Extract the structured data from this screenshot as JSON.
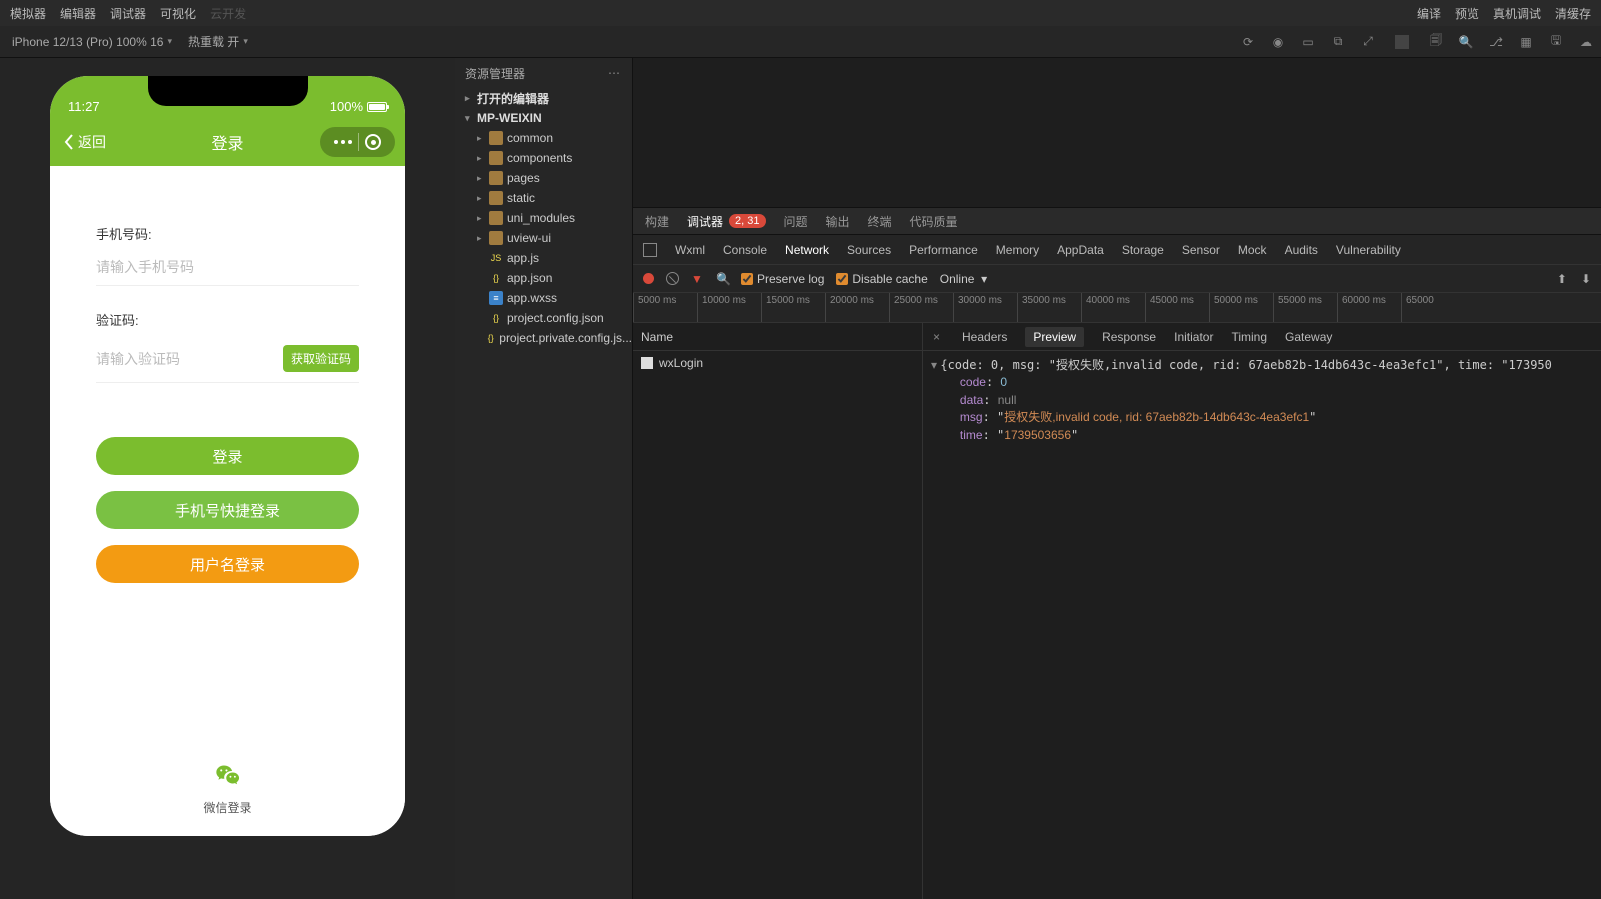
{
  "topMenu": {
    "left": [
      "模拟器",
      "编辑器",
      "调试器",
      "可视化"
    ],
    "leftDisabled": "云开发",
    "right": [
      "编译",
      "预览",
      "真机调试",
      "清缓存"
    ]
  },
  "subBar": {
    "device": "iPhone 12/13 (Pro) 100% 16",
    "hotreload": "热重载 开"
  },
  "explorer": {
    "title": "资源管理器",
    "openEditors": "打开的编辑器",
    "project": "MP-WEIXIN",
    "folders": [
      "common",
      "components",
      "pages",
      "static",
      "uni_modules",
      "uview-ui"
    ],
    "files": [
      "app.js",
      "app.json",
      "app.wxss",
      "project.config.json",
      "project.private.config.js..."
    ]
  },
  "phone": {
    "time": "11:27",
    "battery": "100%",
    "back": "返回",
    "title": "登录",
    "phoneLabel": "手机号码:",
    "phonePH": "请输入手机号码",
    "codeLabel": "验证码:",
    "codePH": "请输入验证码",
    "getCode": "获取验证码",
    "btnLogin": "登录",
    "btnQuick": "手机号快捷登录",
    "btnUser": "用户名登录",
    "wechat": "微信登录"
  },
  "devTabs": {
    "items": [
      "构建",
      "调试器",
      "问题",
      "输出",
      "终端",
      "代码质量"
    ],
    "badge": "2, 31",
    "active": "调试器"
  },
  "panelTabs": {
    "items": [
      "Wxml",
      "Console",
      "Network",
      "Sources",
      "Performance",
      "Memory",
      "AppData",
      "Storage",
      "Sensor",
      "Mock",
      "Audits",
      "Vulnerability"
    ],
    "active": "Network"
  },
  "netToolbar": {
    "preserve": "Preserve log",
    "disable": "Disable cache",
    "online": "Online"
  },
  "ruler": [
    "5000 ms",
    "10000 ms",
    "15000 ms",
    "20000 ms",
    "25000 ms",
    "30000 ms",
    "35000 ms",
    "40000 ms",
    "45000 ms",
    "50000 ms",
    "55000 ms",
    "60000 ms",
    "65000"
  ],
  "reqList": {
    "header": "Name",
    "items": [
      "wxLogin"
    ]
  },
  "detailTabs": {
    "items": [
      "Headers",
      "Preview",
      "Response",
      "Initiator",
      "Timing",
      "Gateway"
    ],
    "active": "Preview"
  },
  "preview": {
    "summary": "{code: 0, msg: \"授权失败,invalid code, rid: 67aeb82b-14db643c-4ea3efc1\", time: \"173950",
    "code": "0",
    "data": "null",
    "msg": "授权失败,invalid code, rid: 67aeb82b-14db643c-4ea3efc1",
    "time": "1739503656"
  }
}
